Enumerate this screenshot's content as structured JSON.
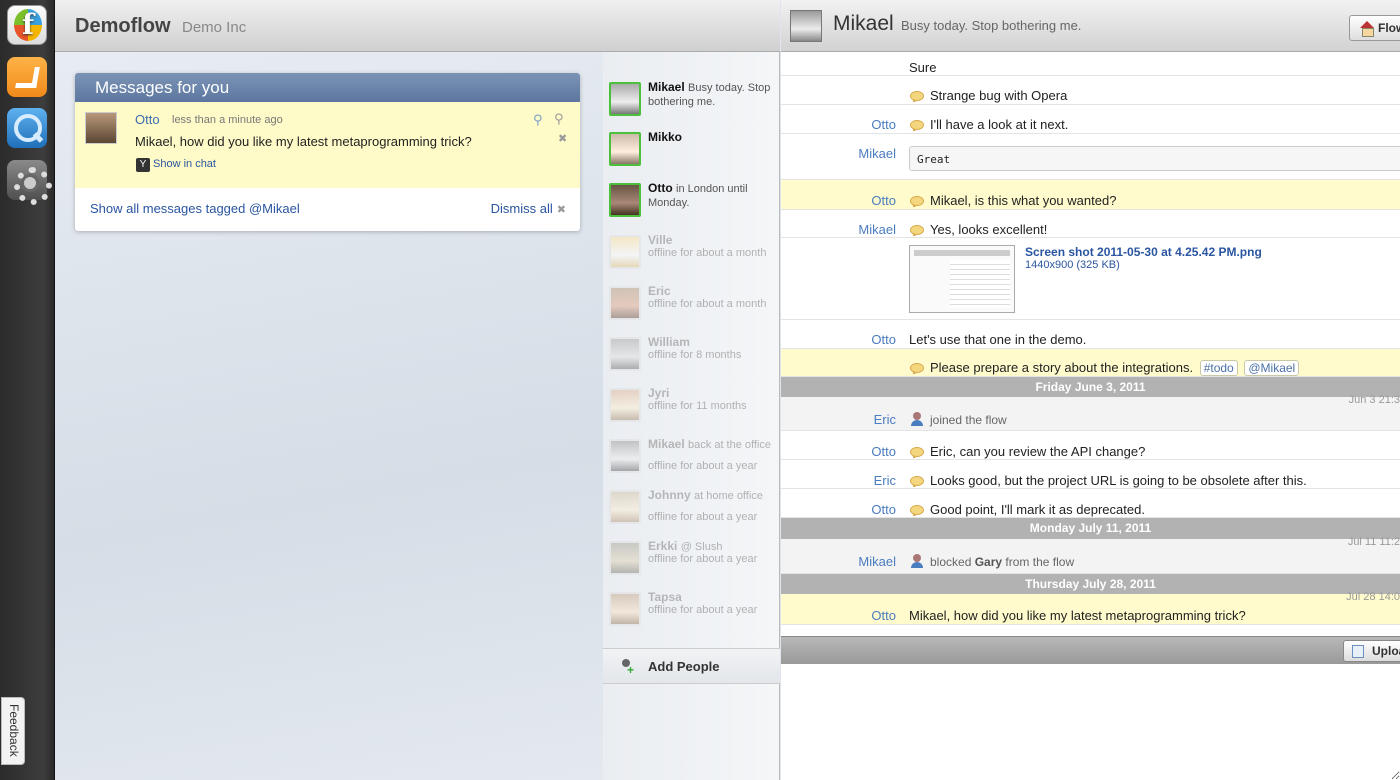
{
  "dock": {
    "apps": [
      "flowdock-app-icon",
      "inbox-app-icon",
      "search-app-icon",
      "settings-app-icon"
    ],
    "feedback_label": "Feedback"
  },
  "topbar": {
    "flow_name": "Demoflow",
    "org_name": "Demo Inc"
  },
  "inbox": {
    "panel_title": "Messages for you",
    "message": {
      "sender": "Otto",
      "time": "less than a minute ago",
      "text": "Mikael, how did you like my latest metaprogramming trick?",
      "show_in_chat": "Show in chat"
    },
    "show_all_label": "Show all messages tagged @Mikael",
    "dismiss_all_label": "Dismiss all"
  },
  "users": [
    {
      "name": "Mikael",
      "status": "Busy today. Stop bothering me.",
      "online": true
    },
    {
      "name": "Mikko",
      "status": "",
      "online": true
    },
    {
      "name": "Otto",
      "status": "in London until Monday.",
      "online": true
    },
    {
      "name": "Ville",
      "status": "",
      "sub": "offline for about a month",
      "online": false
    },
    {
      "name": "Eric",
      "status": "",
      "sub": "offline for about a month",
      "online": false
    },
    {
      "name": "William",
      "status": "",
      "sub": "offline for 8 months",
      "online": false
    },
    {
      "name": "Jyri",
      "status": "",
      "sub": "offline for 11 months",
      "online": false
    },
    {
      "name": "Mikael",
      "status": "back at the office",
      "sub": "offline for about a year",
      "online": false
    },
    {
      "name": "Johnny",
      "status": "at home office",
      "sub": "offline for about a year",
      "online": false
    },
    {
      "name": "Erkki",
      "status": "@ Slush",
      "sub": "offline for about a year",
      "online": false
    },
    {
      "name": "Tapsa",
      "status": "",
      "sub": "offline for about a year",
      "online": false
    }
  ],
  "add_people_label": "Add People",
  "chat": {
    "title": "Mikael",
    "status": "Busy today. Stop bothering me.",
    "flow_button": "Flow",
    "messages": [
      {
        "author": "",
        "text": "Sure"
      },
      {
        "author": "",
        "text": "Strange bug with Opera"
      },
      {
        "author": "Otto",
        "text": "I'll have a look at it next."
      },
      {
        "author": "Mikael",
        "text": "Great"
      },
      {
        "author": "Otto",
        "text": "Mikael, is this what you wanted?"
      },
      {
        "author": "Mikael",
        "text": "Yes, looks excellent!"
      },
      {
        "author": "",
        "file_name": "Screen shot 2011-05-30 at 4.25.42 PM.png",
        "file_size": "1440x900 (325 KB)"
      },
      {
        "author": "Otto",
        "text": "Let's use that one in the demo."
      },
      {
        "author": "",
        "text": "Please prepare a story about the integrations.",
        "tags": [
          "#todo",
          "@Mikael"
        ]
      },
      {
        "day": "Friday June 3, 2011"
      },
      {
        "author": "Eric",
        "text": "joined the flow",
        "ts": "Jun 3 21:3"
      },
      {
        "author": "Otto",
        "text": "Eric, can you review the API change?"
      },
      {
        "author": "Eric",
        "text": "Looks good, but the project URL is going to be obsolete after this."
      },
      {
        "author": "Otto",
        "text": "Good point, I'll mark it as deprecated."
      },
      {
        "day": "Monday July 11, 2011"
      },
      {
        "author": "Mikael",
        "text_pre": "blocked",
        "text_bold": "Gary",
        "text_post": "from the flow",
        "ts": "Jul 11 11:2"
      },
      {
        "day": "Thursday July 28, 2011"
      },
      {
        "author": "Otto",
        "text": "Mikael, how did you like my latest metaprogramming trick?",
        "ts": "Jul 28 14:0"
      }
    ],
    "upload_button": "Upload"
  }
}
